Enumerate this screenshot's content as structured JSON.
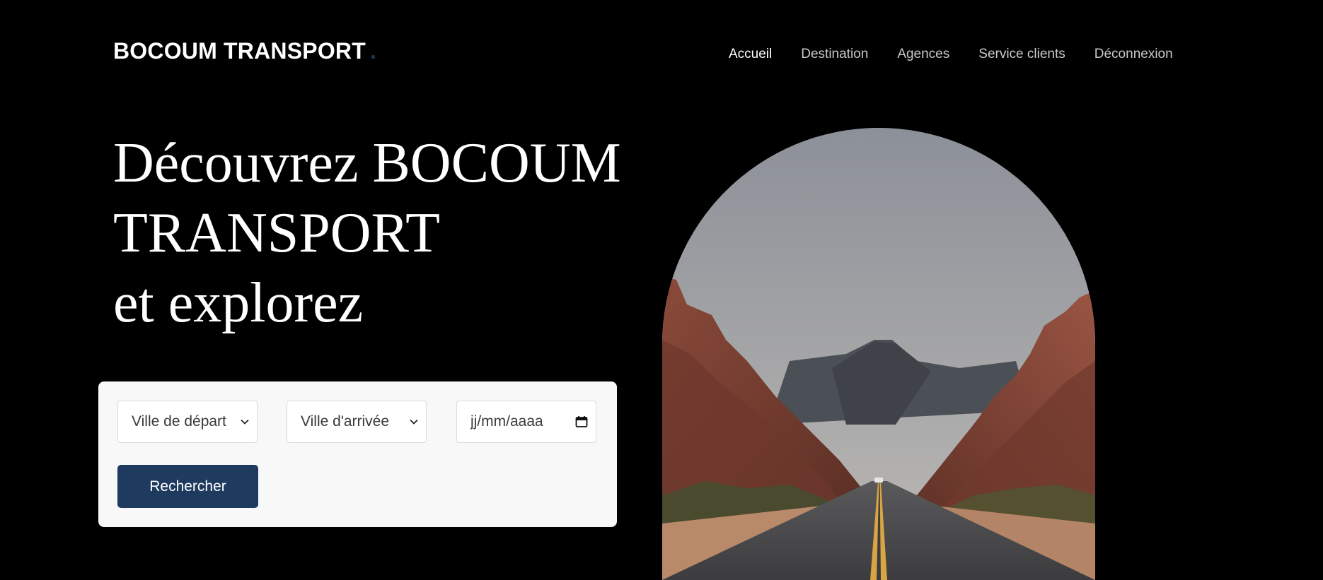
{
  "header": {
    "logo_text": "BOCOUM TRANSPORT",
    "logo_dot": ".",
    "nav": [
      {
        "label": "Accueil",
        "active": true
      },
      {
        "label": "Destination",
        "active": false
      },
      {
        "label": "Agences",
        "active": false
      },
      {
        "label": "Service clients",
        "active": false
      },
      {
        "label": "Déconnexion",
        "active": false
      }
    ]
  },
  "hero": {
    "title_line1": "Découvrez BOCOUM",
    "title_line2": "TRANSPORT",
    "title_line3": "et explorez"
  },
  "search": {
    "departure_select": "Ville de départ",
    "arrival_select": "Ville d'arrivée",
    "date_placeholder": "jj/mm/aaaa",
    "button_label": "Rechercher"
  },
  "icons": {
    "select_chevron": "chevron-down-icon",
    "date_picker": "calendar-icon"
  },
  "colors": {
    "background": "#000000",
    "accent": "#1e3a5f",
    "card": "#f8f8f8",
    "nav_inactive": "#c9c9c9",
    "text": "#ffffff"
  }
}
